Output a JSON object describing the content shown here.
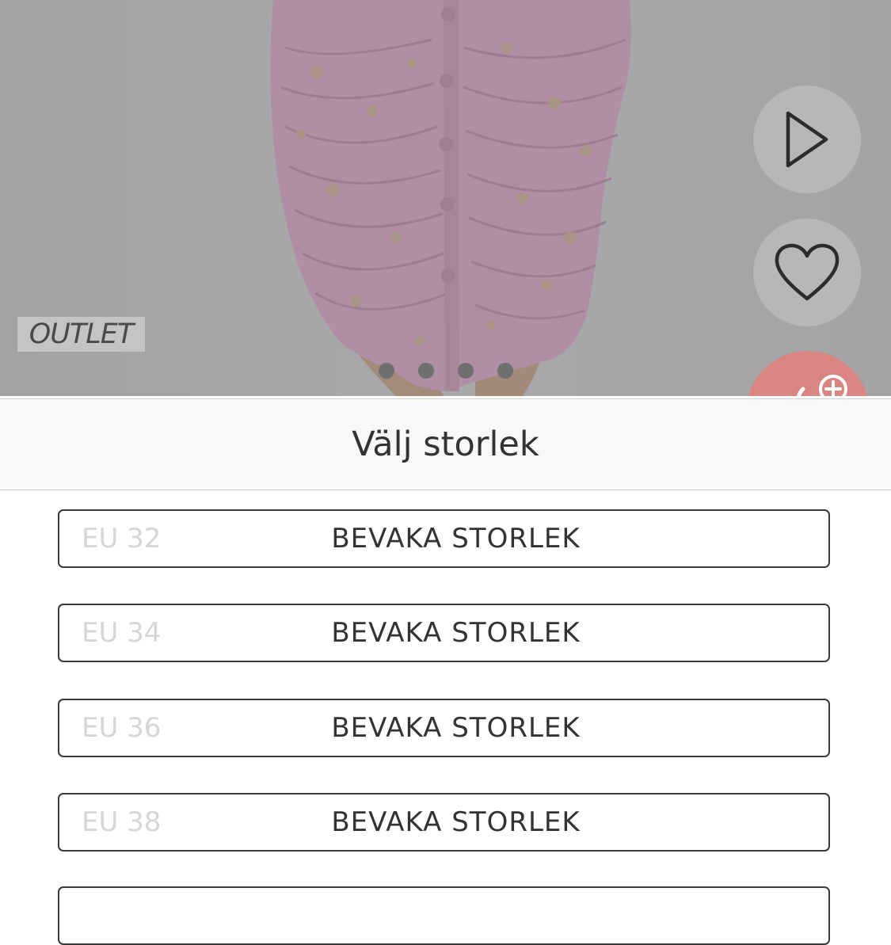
{
  "product": {
    "badge": "OUTLET",
    "gallery_count": 4,
    "gallery_active_index": 0
  },
  "actions": {
    "play_icon": "play-icon",
    "favorite_icon": "heart-icon",
    "add_icon": "add-to-bag-icon"
  },
  "size_sheet": {
    "title": "Välj storlek",
    "sizes": [
      {
        "label": "EU 32",
        "action": "BEVAKA STORLEK"
      },
      {
        "label": "EU 34",
        "action": "BEVAKA STORLEK"
      },
      {
        "label": "EU 36",
        "action": "BEVAKA STORLEK"
      },
      {
        "label": "EU 38",
        "action": "BEVAKA STORLEK"
      }
    ]
  },
  "colors": {
    "overlay": "#a6a5a7",
    "skirt": "#e8a4c8",
    "add_button": "#d98683",
    "text": "#333333",
    "disabled_text": "#d6d6d6"
  }
}
